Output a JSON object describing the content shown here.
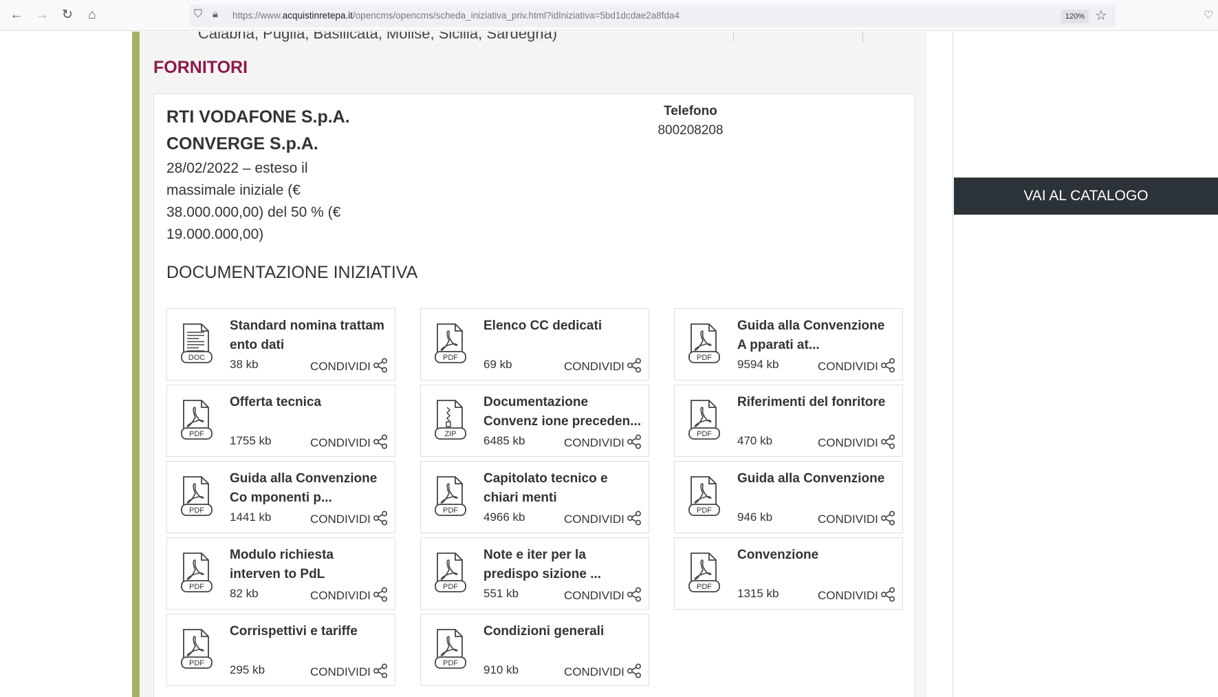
{
  "browser": {
    "url_prefix": "https://www.",
    "url_domain": "acquistinretepa.it",
    "url_path": "/opencms/opencms/scheda_iniziativa_priv.html?idIniziativa=5bd1dcdae2a8fda4",
    "zoom": "120%",
    "icons": [
      "back-icon",
      "forward-icon",
      "reload-icon",
      "home-icon",
      "shield-icon",
      "lock-icon",
      "star-icon",
      "pocket-icon"
    ]
  },
  "page": {
    "cut_text": "Calabria, Puglia, Basilicata, Molise, Sicilia, Sardegna)",
    "section_title": "FORNITORI",
    "supplier": {
      "name": "RTI VODAFONE S.p.A. CONVERGE S.p.A.",
      "note": "28/02/2022 – esteso il massimale iniziale (€ 38.000.000,00) del 50 % (€ 19.000.000,00)",
      "phone_label": "Telefono",
      "phone": "800208208"
    },
    "documents_title": "DOCUMENTAZIONE INIZIATIVA",
    "share_label": "CONDIVIDI",
    "documents": [
      {
        "name": "Standard nomina trattam ento dati",
        "size": "38 kb",
        "type": "DOC"
      },
      {
        "name": "Elenco CC dedicati",
        "size": "69 kb",
        "type": "PDF"
      },
      {
        "name": "Guida alla Convenzione A pparati at...",
        "size": "9594 kb",
        "type": "PDF"
      },
      {
        "name": "Offerta tecnica",
        "size": "1755 kb",
        "type": "PDF"
      },
      {
        "name": "Documentazione Convenz ione preceden...",
        "size": "6485 kb",
        "type": "ZIP"
      },
      {
        "name": "Riferimenti del fonritore",
        "size": "470 kb",
        "type": "PDF"
      },
      {
        "name": "Guida alla Convenzione Co mponenti p...",
        "size": "1441 kb",
        "type": "PDF"
      },
      {
        "name": "Capitolato tecnico e chiari menti",
        "size": "4966 kb",
        "type": "PDF"
      },
      {
        "name": "Guida alla Convenzione",
        "size": "946 kb",
        "type": "PDF"
      },
      {
        "name": "Modulo richiesta interven to PdL",
        "size": "82 kb",
        "type": "PDF"
      },
      {
        "name": "Note e iter per la predispo sizione ...",
        "size": "551 kb",
        "type": "PDF"
      },
      {
        "name": "Convenzione",
        "size": "1315 kb",
        "type": "PDF"
      },
      {
        "name": "Corrispettivi e tariffe",
        "size": "295 kb",
        "type": "PDF"
      },
      {
        "name": "Condizioni generali",
        "size": "910 kb",
        "type": "PDF"
      }
    ],
    "catalog_button": "VAI AL CATALOGO"
  },
  "colors": {
    "accent_title": "#8b1a4a",
    "green_bar": "#a7b163",
    "catalog_button_bg": "#2c3338"
  }
}
